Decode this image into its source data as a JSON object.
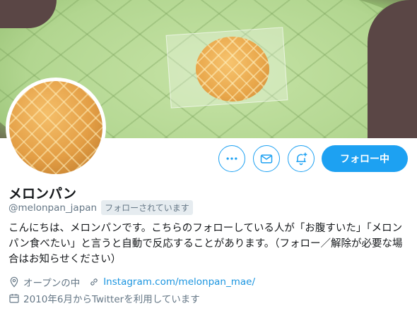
{
  "profile": {
    "display_name": "メロンパン",
    "handle": "@melonpan_japan",
    "follows_you_badge": "フォローされています",
    "bio": "こんにちは、メロンパンです。こちらのフォローしている人が「お腹すいた」「メロンパン食べたい」と言うと自動で反応することがあります。（フォロー／解除が必要な場合はお知らせください）",
    "location": "オープンの中",
    "website": "Instagram.com/melonpan_mae/",
    "joined": "2010年6月からTwitterを利用しています"
  },
  "actions": {
    "more_icon": "more-icon",
    "message_icon": "envelope-icon",
    "notify_icon": "bell-plus-icon",
    "follow_button_label": "フォロー中"
  },
  "colors": {
    "accent": "#1da1f2",
    "link": "#1b95e0",
    "secondary_text": "#657786"
  }
}
